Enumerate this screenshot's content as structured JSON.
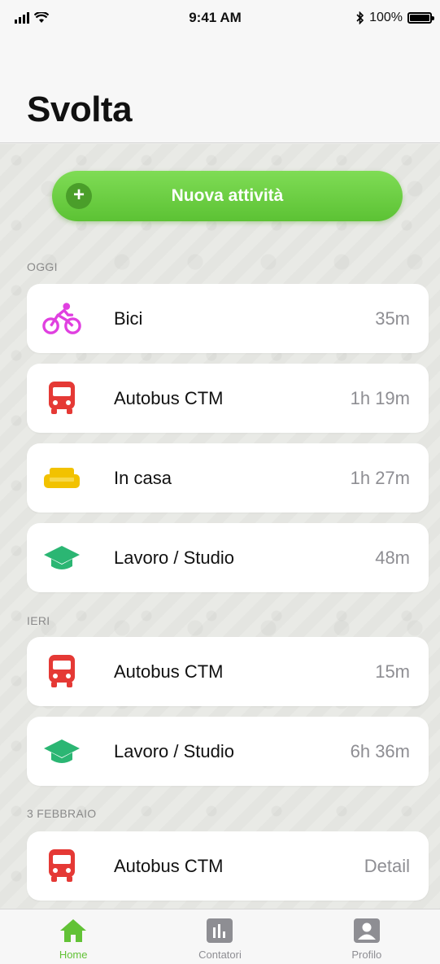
{
  "status_bar": {
    "time": "9:41 AM",
    "battery": "100%"
  },
  "header": {
    "title": "Svolta"
  },
  "new_activity_button": {
    "label": "Nuova attività",
    "plus": "+"
  },
  "sections": [
    {
      "label": "OGGI"
    },
    {
      "label": "IERI"
    },
    {
      "label": "3 FEBBRAIO"
    }
  ],
  "activities": [
    {
      "label": "Bici",
      "duration": "35m",
      "icon": "bicycle-icon",
      "color": "#e040e0"
    },
    {
      "label": "Autobus CTM",
      "duration": "1h 19m",
      "icon": "bus-icon",
      "color": "#e53935"
    },
    {
      "label": "In casa",
      "duration": "1h 27m",
      "icon": "sofa-icon",
      "color": "#f2c200"
    },
    {
      "label": "Lavoro / Studio",
      "duration": "48m",
      "icon": "graduation-cap-icon",
      "color": "#2bb673"
    },
    {
      "label": "Autobus CTM",
      "duration": "15m",
      "icon": "bus-icon",
      "color": "#e53935"
    },
    {
      "label": "Lavoro / Studio",
      "duration": "6h 36m",
      "icon": "graduation-cap-icon",
      "color": "#2bb673"
    },
    {
      "label": "Autobus CTM",
      "duration": "Detail",
      "icon": "bus-icon",
      "color": "#e53935"
    }
  ],
  "tabs": [
    {
      "label": "Home",
      "icon": "home-icon",
      "active": true
    },
    {
      "label": "Contatori",
      "icon": "bar-chart-icon",
      "active": false
    },
    {
      "label": "Profilo",
      "icon": "profile-icon",
      "active": false
    }
  ],
  "colors": {
    "accent": "#62c236",
    "inactive": "#8e8e93"
  }
}
